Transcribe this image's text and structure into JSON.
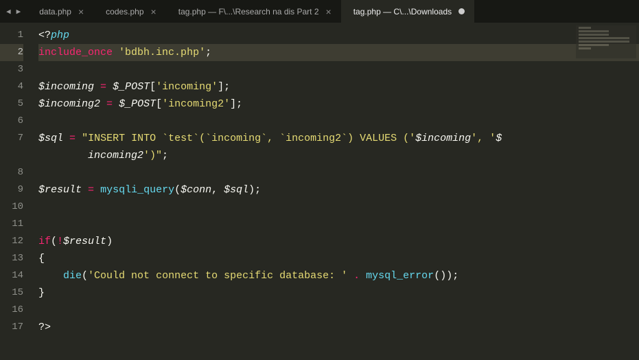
{
  "nav": {
    "back": "◀",
    "forward": "▶"
  },
  "tabs": [
    {
      "label": "data.php",
      "active": false,
      "dirty": false
    },
    {
      "label": "codes.php",
      "active": false,
      "dirty": false
    },
    {
      "label": "tag.php — F\\...\\Research na dis Part 2",
      "active": false,
      "dirty": false
    },
    {
      "label": "tag.php — C\\...\\Downloads",
      "active": true,
      "dirty": true
    }
  ],
  "close_glyph": "×",
  "highlighted_line": 2,
  "lines": [
    {
      "n": "1",
      "tokens": [
        [
          "tok-tag",
          "<?"
        ],
        [
          "tok-const",
          "php"
        ]
      ]
    },
    {
      "n": "2",
      "tokens": [
        [
          "tok-kw",
          "include_once"
        ],
        [
          "",
          " "
        ],
        [
          "tok-str",
          "'bdbh.inc.php'"
        ],
        [
          "",
          ";"
        ]
      ]
    },
    {
      "n": "3",
      "tokens": []
    },
    {
      "n": "4",
      "tokens": [
        [
          "tok-var",
          "$incoming"
        ],
        [
          "",
          " "
        ],
        [
          "tok-kw",
          "="
        ],
        [
          "",
          " "
        ],
        [
          "tok-var",
          "$_POST"
        ],
        [
          "",
          "["
        ],
        [
          "tok-str",
          "'incoming'"
        ],
        [
          "",
          "];"
        ]
      ]
    },
    {
      "n": "5",
      "tokens": [
        [
          "tok-var",
          "$incoming2"
        ],
        [
          "",
          " "
        ],
        [
          "tok-kw",
          "="
        ],
        [
          "",
          " "
        ],
        [
          "tok-var",
          "$_POST"
        ],
        [
          "",
          "["
        ],
        [
          "tok-str",
          "'incoming2'"
        ],
        [
          "",
          "];"
        ]
      ]
    },
    {
      "n": "6",
      "tokens": []
    },
    {
      "n": "7",
      "tokens": [
        [
          "tok-var",
          "$sql"
        ],
        [
          "",
          " "
        ],
        [
          "tok-kw",
          "="
        ],
        [
          "",
          " "
        ],
        [
          "tok-str",
          "\"INSERT INTO `test`(`incoming`, `incoming2`) VALUES ('"
        ],
        [
          "tok-var",
          "$incoming"
        ],
        [
          "tok-str",
          "', '"
        ],
        [
          "tok-var",
          "$"
        ]
      ]
    },
    {
      "n": "",
      "tokens": [
        [
          "",
          "        "
        ],
        [
          "tok-var",
          "incoming2"
        ],
        [
          "tok-str",
          "')\""
        ],
        [
          "",
          ";"
        ]
      ]
    },
    {
      "n": "8",
      "tokens": []
    },
    {
      "n": "9",
      "tokens": [
        [
          "tok-var",
          "$result"
        ],
        [
          "",
          " "
        ],
        [
          "tok-kw",
          "="
        ],
        [
          "",
          " "
        ],
        [
          "tok-fn",
          "mysqli_query"
        ],
        [
          "",
          "("
        ],
        [
          "tok-var",
          "$conn"
        ],
        [
          "",
          ", "
        ],
        [
          "tok-var",
          "$sql"
        ],
        [
          "",
          ");"
        ]
      ]
    },
    {
      "n": "10",
      "tokens": []
    },
    {
      "n": "11",
      "tokens": []
    },
    {
      "n": "12",
      "tokens": [
        [
          "tok-kw",
          "if"
        ],
        [
          "",
          "("
        ],
        [
          "tok-kw",
          "!"
        ],
        [
          "tok-var",
          "$result"
        ],
        [
          "",
          ")"
        ]
      ]
    },
    {
      "n": "13",
      "tokens": [
        [
          "",
          "{"
        ]
      ]
    },
    {
      "n": "14",
      "tokens": [
        [
          "",
          "    "
        ],
        [
          "tok-fn",
          "die"
        ],
        [
          "",
          "("
        ],
        [
          "tok-str",
          "'Could not connect to specific database: '"
        ],
        [
          "",
          " "
        ],
        [
          "tok-kw",
          "."
        ],
        [
          "",
          " "
        ],
        [
          "tok-fn",
          "mysql_error"
        ],
        [
          "",
          "());"
        ]
      ]
    },
    {
      "n": "15",
      "tokens": [
        [
          "",
          "}"
        ]
      ]
    },
    {
      "n": "16",
      "tokens": []
    },
    {
      "n": "17",
      "tokens": [
        [
          "tok-tag",
          "?>"
        ]
      ]
    }
  ]
}
